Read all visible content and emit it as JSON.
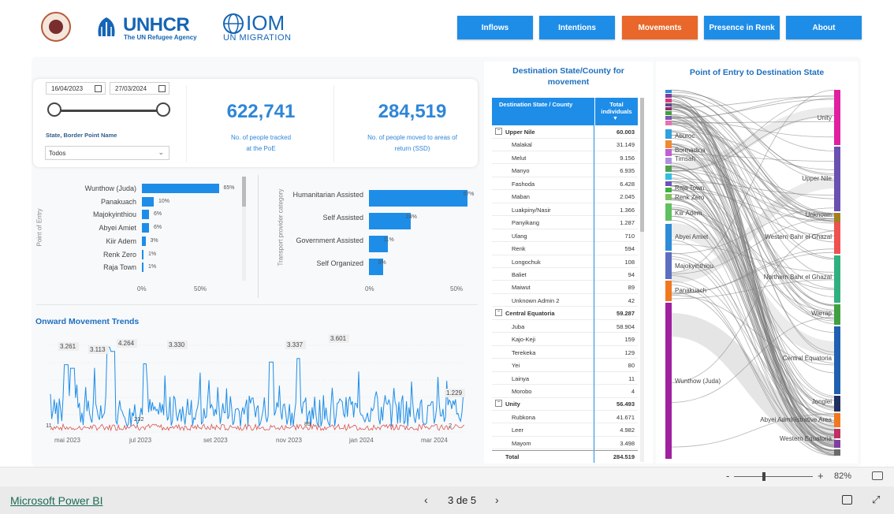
{
  "header": {
    "logo_unhcr_main": "UNHCR",
    "logo_unhcr_sub": "The UN Refugee Agency",
    "logo_iom_main": "IOM",
    "logo_iom_sub": "UN MIGRATION",
    "tabs": [
      {
        "label": "Inflows",
        "active": false
      },
      {
        "label": "Intentions",
        "active": false
      },
      {
        "label": "Movements",
        "active": true
      },
      {
        "label": "Presence in Renk",
        "active": false
      },
      {
        "label": "About",
        "active": false
      }
    ]
  },
  "filters": {
    "date_start": "16/04/2023",
    "date_end": "27/03/2024",
    "state_label": "State, Border Point Name",
    "state_value": "Todos"
  },
  "kpis": [
    {
      "value": "622,741",
      "label_line1": "No. of people tracked",
      "label_line2": "at the PoE"
    },
    {
      "value": "284,519",
      "label_line1": "No. of people moved to areas of",
      "label_line2": "return (SSD)"
    }
  ],
  "poe_chart": {
    "axis_title": "Point of Entry",
    "categories": [
      "Wunthow (Juda)",
      "Panakuach",
      "Majokyinthiou",
      "Abyei Amiet",
      "Kiir Adem",
      "Renk Zero",
      "Raja Town"
    ],
    "values": [
      65,
      10,
      6,
      6,
      3,
      1,
      1
    ],
    "value_labels": [
      "65%",
      "10%",
      "6%",
      "6%",
      "3%",
      "1%",
      "1%"
    ],
    "ticks": [
      "0%",
      "50%"
    ]
  },
  "transport_chart": {
    "axis_title": "Transport provider category",
    "categories": [
      "Humanitarian Assisted",
      "Self Assisted",
      "Government Assisted",
      "Self Organized"
    ],
    "values": [
      57,
      24,
      11,
      8
    ],
    "value_labels": [
      "57%",
      "24%",
      "11%",
      "8%"
    ],
    "ticks": [
      "0%",
      "50%"
    ]
  },
  "trend": {
    "title": "Onward Movement Trends",
    "x_ticks": [
      "mai 2023",
      "jul 2023",
      "set 2023",
      "nov 2023",
      "jan 2024",
      "mar 2024"
    ],
    "peak_labels": [
      "3.261",
      "3.113",
      "4.264",
      "3.330",
      "3.337",
      "3.601",
      "1.229"
    ],
    "low_labels": [
      "11",
      "232",
      "89",
      "2"
    ]
  },
  "destination_table": {
    "title_line1": "Destination State/County for",
    "title_line2": "movement",
    "col1": "Destination State / County",
    "col2_line1": "Total",
    "col2_line2": "individuals",
    "rows": [
      {
        "name": "Upper Nile",
        "value": "60.003",
        "group": true
      },
      {
        "name": "Malakal",
        "value": "31.149",
        "group": false
      },
      {
        "name": "Melut",
        "value": "9.156",
        "group": false
      },
      {
        "name": "Manyo",
        "value": "6.935",
        "group": false
      },
      {
        "name": "Fashoda",
        "value": "6.428",
        "group": false
      },
      {
        "name": "Maban",
        "value": "2.045",
        "group": false
      },
      {
        "name": "Luakpiny/Nasir",
        "value": "1.366",
        "group": false
      },
      {
        "name": "Panyikang",
        "value": "1.287",
        "group": false
      },
      {
        "name": "Ulang",
        "value": "710",
        "group": false
      },
      {
        "name": "Renk",
        "value": "594",
        "group": false
      },
      {
        "name": "Longochuk",
        "value": "108",
        "group": false
      },
      {
        "name": "Baliet",
        "value": "94",
        "group": false
      },
      {
        "name": "Maiwut",
        "value": "89",
        "group": false
      },
      {
        "name": "Unknown Admin 2",
        "value": "42",
        "group": false
      },
      {
        "name": "Central Equatoria",
        "value": "59.287",
        "group": true
      },
      {
        "name": "Juba",
        "value": "58.904",
        "group": false
      },
      {
        "name": "Kajo-Keji",
        "value": "159",
        "group": false
      },
      {
        "name": "Terekeka",
        "value": "129",
        "group": false
      },
      {
        "name": "Yei",
        "value": "80",
        "group": false
      },
      {
        "name": "Lainya",
        "value": "11",
        "group": false
      },
      {
        "name": "Morobo",
        "value": "4",
        "group": false
      },
      {
        "name": "Unity",
        "value": "56.493",
        "group": true
      },
      {
        "name": "Rubkona",
        "value": "41.671",
        "group": false
      },
      {
        "name": "Leer",
        "value": "4.982",
        "group": false
      },
      {
        "name": "Mayom",
        "value": "3.498",
        "group": false
      }
    ],
    "total_label": "Total",
    "total_value": "284.519"
  },
  "sankey": {
    "title": "Point of Entry to Destination State",
    "left_labels": [
      "Aburoc",
      "Bormadina",
      "Timsah",
      "Raja Town",
      "Renk Zero",
      "Kiir Adem",
      "Abyei Amiet",
      "Majokyinthiou",
      "Panakuach",
      "Wunthow (Juda)"
    ],
    "right_labels": [
      "Unity",
      "Upper Nile",
      "Unknown",
      "Western Bahr el Ghazal",
      "Northern Bahr el Ghazal",
      "Warrap",
      "Central Equatoria",
      "Jonglei",
      "Abyei Administrative Area",
      "Western Equatoria"
    ]
  },
  "footer": {
    "brand": "Microsoft Power BI",
    "page": "3 de 5",
    "zoom": "82%",
    "zoom_minus": "-",
    "zoom_plus": "+"
  },
  "colors": {
    "accent": "#1e8de8",
    "active_tab": "#e9672a",
    "kpi_text": "#2e86d8",
    "header_blue": "#1e8de8"
  }
}
